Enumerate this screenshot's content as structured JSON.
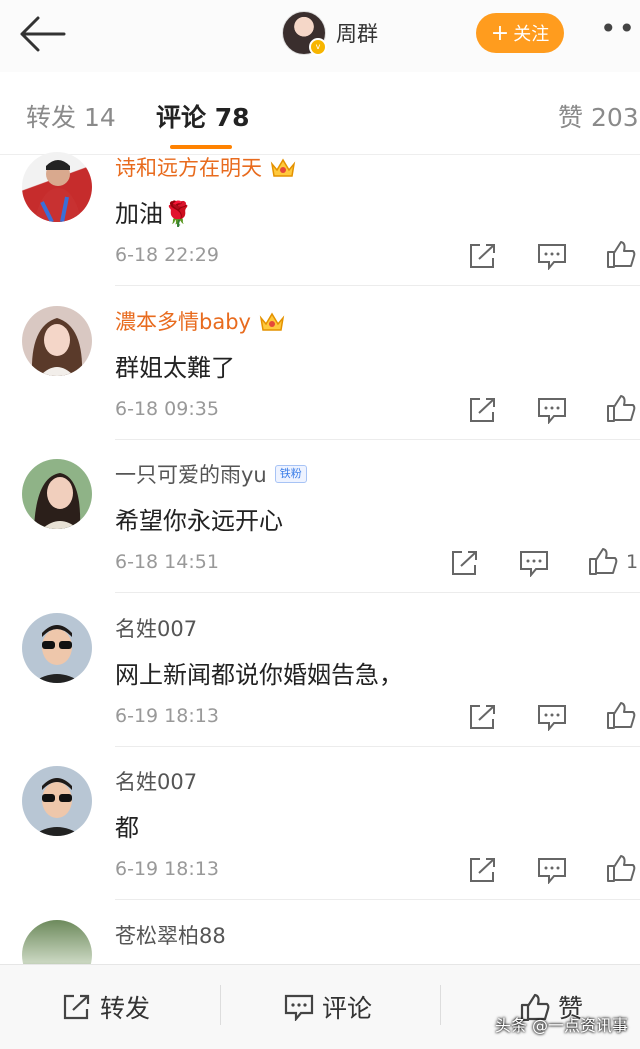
{
  "header": {
    "user_name": "周群",
    "follow_label": "关注",
    "follow_plus": "+",
    "more_label": "•••",
    "verified_badge": "v"
  },
  "tabs": [
    {
      "label": "转发 14"
    },
    {
      "label": "评论 78",
      "active": true
    },
    {
      "label": "赞 203"
    }
  ],
  "comments": [
    {
      "name": "诗和远方在明天",
      "name_style": "vip",
      "badge": "crown",
      "text": "加油🌹",
      "time": "6-18 22:29",
      "likes": ""
    },
    {
      "name": "濃本多情baby",
      "name_style": "vip",
      "badge": "crown",
      "text": "群姐太難了",
      "time": "6-18 09:35",
      "likes": ""
    },
    {
      "name": "一只可爱的雨yu",
      "name_style": "plain",
      "badge": "铁粉",
      "text": "希望你永远开心",
      "time": "6-18 14:51",
      "likes": "1"
    },
    {
      "name": "名姓007",
      "name_style": "plain",
      "badge": "",
      "text": "网上新闻都说你婚姻告急，",
      "time": "6-19 18:13",
      "likes": ""
    },
    {
      "name": "名姓007",
      "name_style": "plain",
      "badge": "",
      "text": "都",
      "time": "6-19 18:13",
      "likes": ""
    },
    {
      "name": "苍松翠柏88",
      "name_style": "plain",
      "badge": "",
      "text": "",
      "time": "",
      "likes": ""
    }
  ],
  "bottom": {
    "repost_label": "转发",
    "comment_label": "评论",
    "like_label": "赞"
  },
  "watermark": "头条 @一点资讯事",
  "colors": {
    "accent": "#ff8200",
    "vip_name": "#e86b1e",
    "follow_bg": "#ff9c1e"
  },
  "icons": [
    "back-arrow-icon",
    "share-icon",
    "comment-icon",
    "like-icon",
    "crown-icon"
  ]
}
